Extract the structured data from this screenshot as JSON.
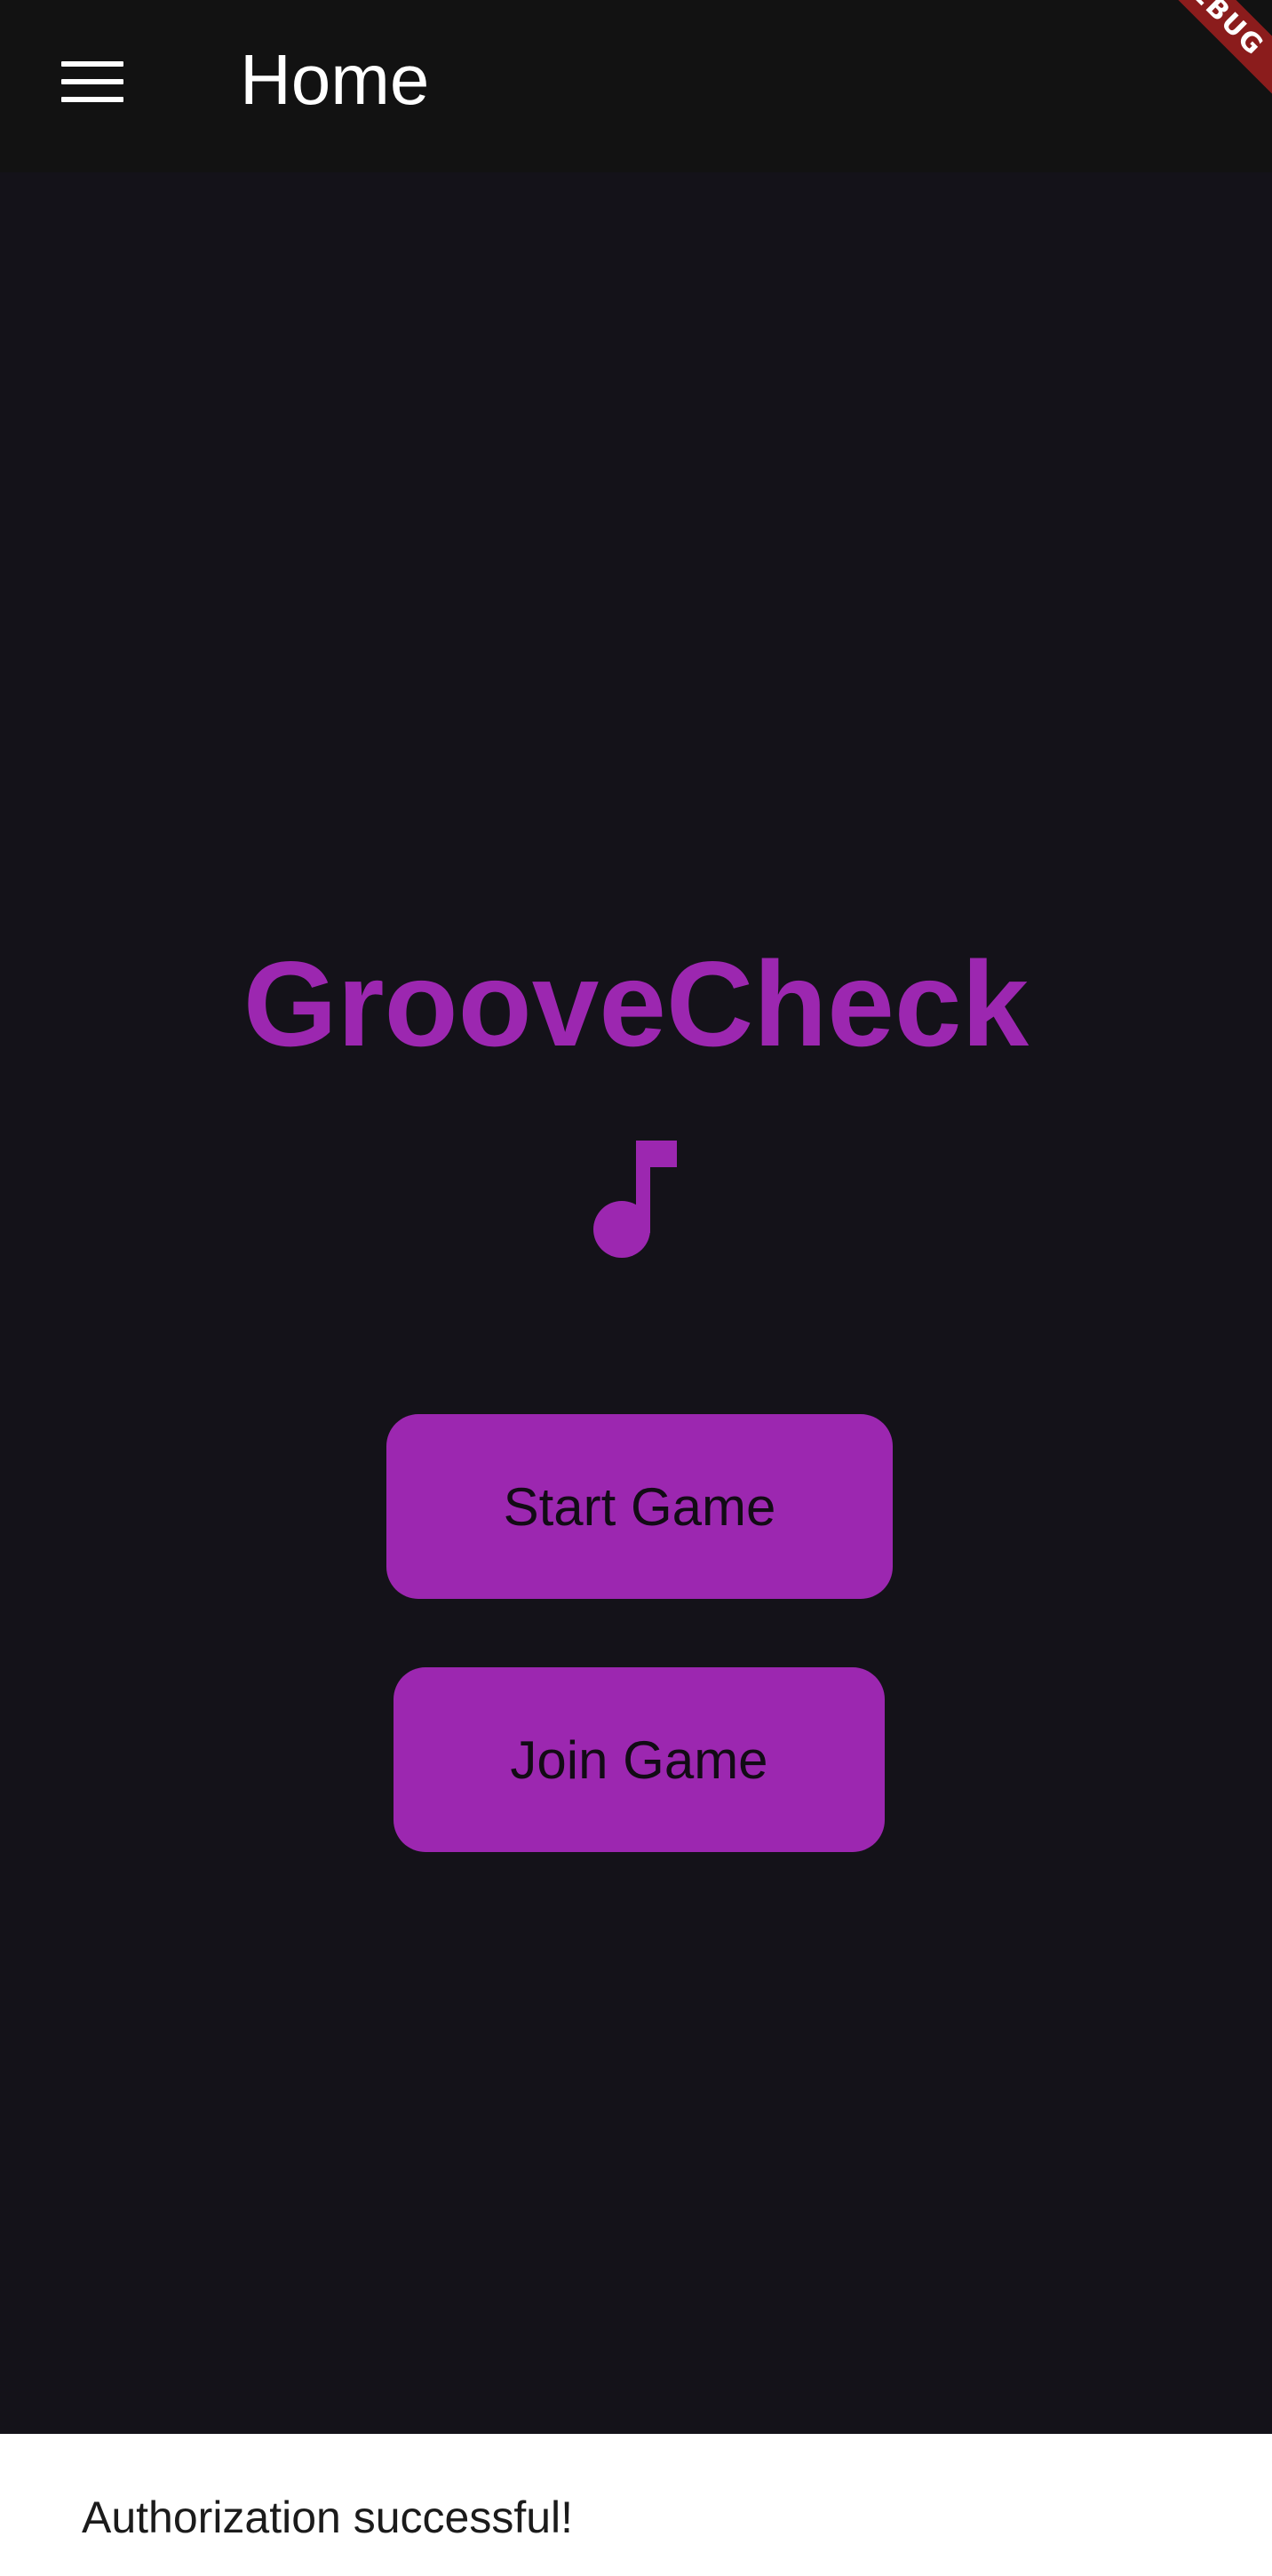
{
  "app_bar": {
    "title": "Home",
    "menu_icon": "menu-icon",
    "debug_banner": "DEBUG"
  },
  "main": {
    "brand_title": "GrooveCheck",
    "brand_icon": "music-note-icon",
    "start_button_label": "Start Game",
    "join_button_label": "Join Game"
  },
  "snackbar": {
    "message": "Authorization successful!"
  },
  "colors": {
    "background": "#141219",
    "app_bar": "#121212",
    "accent": "#9c27b0",
    "button_text": "#120b15",
    "snackbar_background": "#ffffff",
    "debug_banner": "#8b1c1c"
  }
}
